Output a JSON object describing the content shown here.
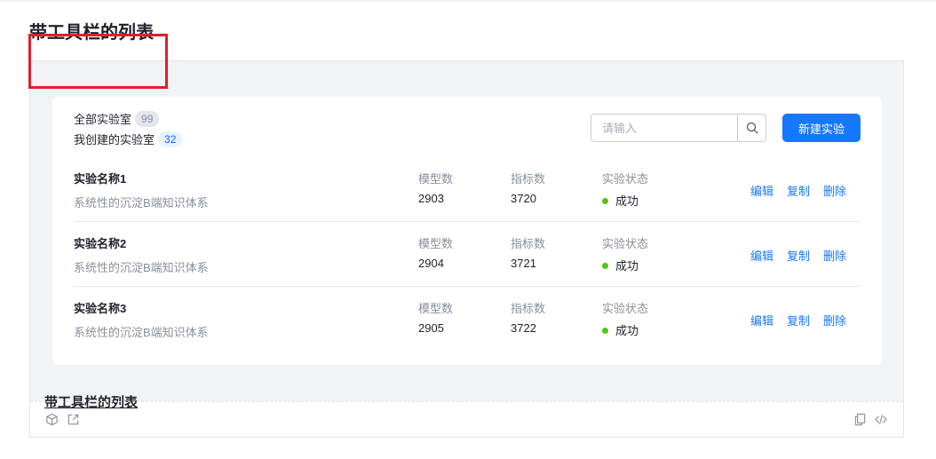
{
  "page": {
    "title": "带工具栏的列表"
  },
  "filters": [
    {
      "label": "全部实验室",
      "count": "99"
    },
    {
      "label": "我创建的实验室",
      "count": "32"
    }
  ],
  "search": {
    "placeholder": "请输入",
    "icon": "search-icon"
  },
  "new_button": {
    "label": "新建实验"
  },
  "columns": {
    "models": "模型数",
    "metrics": "指标数",
    "status": "实验状态"
  },
  "items": [
    {
      "name": "实验名称1",
      "desc": "系统性的沉淀B端知识体系",
      "models": "2903",
      "metrics": "3720",
      "status": "成功"
    },
    {
      "name": "实验名称2",
      "desc": "系统性的沉淀B端知识体系",
      "models": "2904",
      "metrics": "3721",
      "status": "成功"
    },
    {
      "name": "实验名称3",
      "desc": "系统性的沉淀B端知识体系",
      "models": "2905",
      "metrics": "3722",
      "status": "成功"
    }
  ],
  "actions": {
    "edit": "编辑",
    "copy": "复制",
    "delete": "删除"
  },
  "demo": {
    "caption": "带工具栏的列表"
  },
  "toolbar_icons": [
    "cube-icon",
    "external-link-icon",
    "copy-icon",
    "code-icon"
  ],
  "colors": {
    "primary": "#1677ff",
    "success": "#52c41a",
    "highlight": "#e0202a",
    "background": "#f2f3f5"
  }
}
